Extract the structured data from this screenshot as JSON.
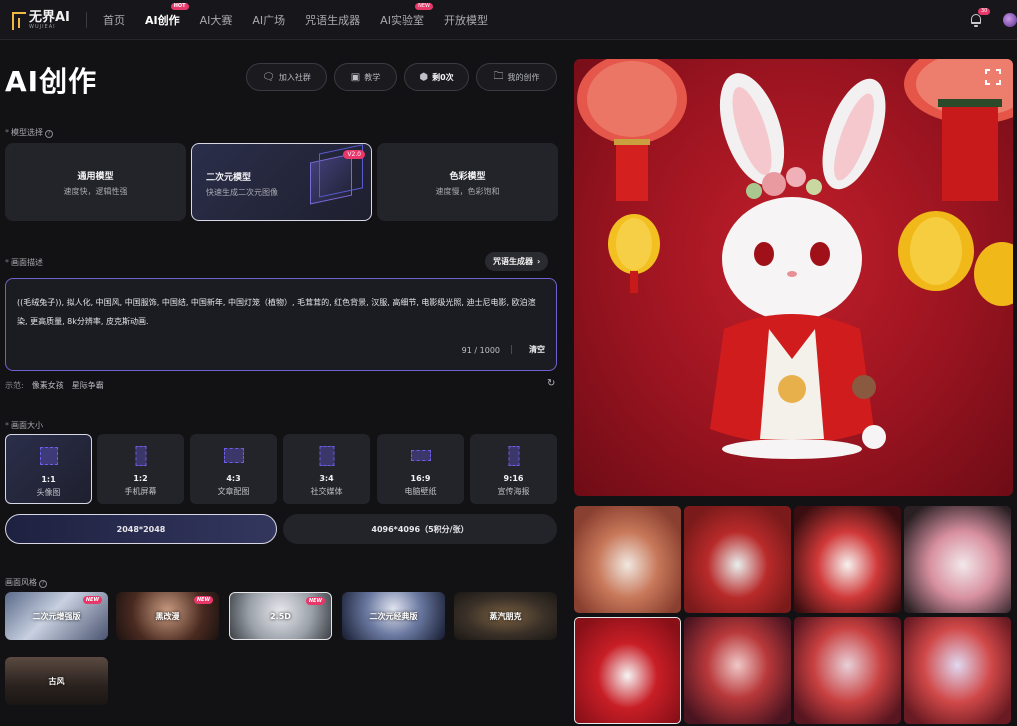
{
  "topbar": {
    "logo": {
      "main": "无界AI",
      "sub": "WUJIEAI"
    },
    "nav": [
      {
        "label": "首页",
        "active": false
      },
      {
        "label": "AI创作",
        "active": true,
        "badge": "HOT"
      },
      {
        "label": "AI大赛",
        "active": false
      },
      {
        "label": "AI广场",
        "active": false
      },
      {
        "label": "咒语生成器",
        "active": false
      },
      {
        "label": "AI实验室",
        "active": false,
        "badge": "NEW"
      },
      {
        "label": "开放模型",
        "active": false
      }
    ],
    "notification_count": "30"
  },
  "header": {
    "title": "AI创作",
    "buttons": [
      {
        "label": "加入社群",
        "icon": "chat-icon"
      },
      {
        "label": "教学",
        "icon": "book-icon"
      },
      {
        "label": "剩0次",
        "icon": "shield-icon"
      },
      {
        "label": "我的创作",
        "icon": "folder-icon"
      }
    ]
  },
  "model": {
    "label": "模型选择",
    "options": [
      {
        "title": "通用模型",
        "desc": "速度快，逻辑性强"
      },
      {
        "title": "二次元模型",
        "desc": "快速生成二次元图像",
        "tag": "V2.0",
        "selected": true
      },
      {
        "title": "色彩模型",
        "desc": "速度慢，色彩饱和"
      }
    ]
  },
  "prompt": {
    "label": "画面描述",
    "generator_label": "咒语生成器",
    "text": "((毛绒兔子)), 拟人化, 中国风, 中国服饰, 中国结, 中国新年, 中国灯笼（植物）, 毛茸茸的, 红色背景, 汉服, 高细节, 电影级光照, 迪士尼电影, 欧泊渲染, 更高质量, 8k分辨率, 皮克斯动画.",
    "count": "91 / 1000",
    "clear_label": "清空",
    "examples_label": "示范:",
    "examples": [
      "像素女孩",
      "星际争霸"
    ]
  },
  "size": {
    "label": "画面大小",
    "ratios": [
      {
        "ratio": "1:1",
        "name": "头像图",
        "selected": true
      },
      {
        "ratio": "1:2",
        "name": "手机屏幕"
      },
      {
        "ratio": "4:3",
        "name": "文章配图"
      },
      {
        "ratio": "3:4",
        "name": "社交媒体"
      },
      {
        "ratio": "16:9",
        "name": "电脑壁纸"
      },
      {
        "ratio": "9:16",
        "name": "宣传海报"
      }
    ],
    "resolutions": [
      {
        "label": "2048*2048",
        "selected": true
      },
      {
        "label": "4096*4096（5积分/张）"
      }
    ]
  },
  "style": {
    "label": "画面风格",
    "options": [
      {
        "label": "二次元增强版",
        "tag": "NEW"
      },
      {
        "label": "黑改漫",
        "tag": "NEW"
      },
      {
        "label": "2.5D",
        "tag": "NEW",
        "selected": true
      },
      {
        "label": "二次元经典版"
      },
      {
        "label": "蒸汽朋克"
      },
      {
        "label": "古风"
      }
    ]
  },
  "colors": {
    "accent": "#6f62d0",
    "badge": "#e8386a",
    "background": "#121215",
    "card": "#23232a"
  }
}
